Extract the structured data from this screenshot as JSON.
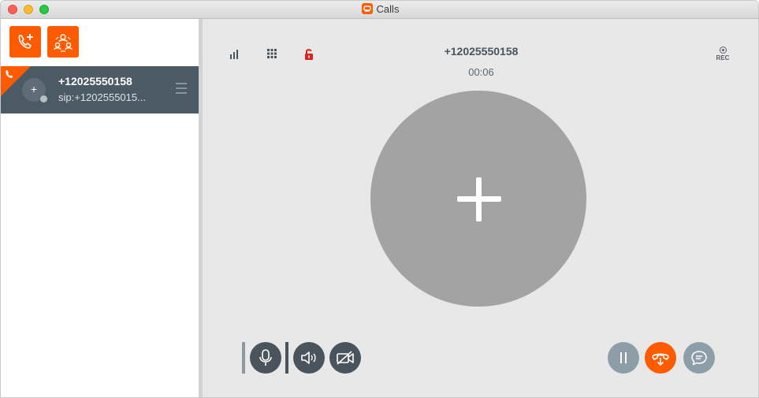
{
  "window": {
    "title": "Calls",
    "accent_color": "#fe5b00"
  },
  "sidebar": {
    "toolbar": [
      {
        "name": "new-call",
        "icon": "phone-plus-icon"
      },
      {
        "name": "conference",
        "icon": "conference-icon"
      }
    ],
    "calls": [
      {
        "number": "+12025550158",
        "sip": "sip:+1202555015...",
        "avatar_glyph": "+",
        "status_icon": "phone-icon"
      }
    ]
  },
  "main": {
    "remote_number": "+12025550158",
    "timer": "00:06",
    "rec_label": "REC",
    "lock_color": "#e0201b",
    "avatar_glyph": "plus"
  },
  "controls": {
    "left": [
      "microphone-icon",
      "speaker-icon",
      "video-off-icon"
    ],
    "right": [
      "pause-icon",
      "hangup-transfer-icon",
      "chat-icon"
    ]
  }
}
